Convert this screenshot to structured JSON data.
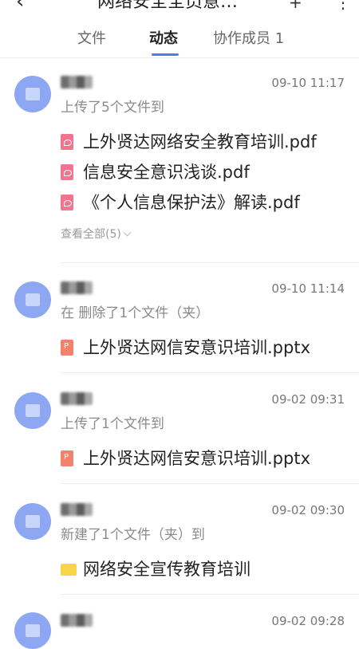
{
  "header": {
    "back_icon": "‹",
    "title": "网络安全全员意…",
    "extra1": "+",
    "extra2": "⋮"
  },
  "tabs": [
    {
      "label": "文件"
    },
    {
      "label": "动态"
    },
    {
      "label": "协作成员 1"
    }
  ],
  "activities": [
    {
      "time": "09-10 11:17",
      "action": "上传了5个文件到",
      "files": [
        {
          "type": "pdf",
          "name": "上外贤达网络安全教育培训.pdf"
        },
        {
          "type": "pdf",
          "name": "信息安全意识浅谈.pdf"
        },
        {
          "type": "pdf",
          "name": "《个人信息保护法》解读.pdf"
        }
      ],
      "view_all": "查看全部(5)"
    },
    {
      "time": "09-10 11:14",
      "action": "在  删除了1个文件（夹）",
      "files": [
        {
          "type": "ppt",
          "name": "上外贤达网信安意识培训.pptx"
        }
      ]
    },
    {
      "time": "09-02 09:31",
      "action": "上传了1个文件到",
      "files": [
        {
          "type": "ppt",
          "name": "上外贤达网信安意识培训.pptx"
        }
      ]
    },
    {
      "time": "09-02 09:30",
      "action": "新建了1个文件（夹）到",
      "files": [
        {
          "type": "folder",
          "name": "网络安全宣传教育培训"
        }
      ]
    },
    {
      "time": "09-02 09:28"
    }
  ],
  "colors": {
    "accent": "#4a7cf6",
    "avatar": "#8ea7f2",
    "pdf": "#f2748f",
    "ppt": "#f2826c",
    "folder": "#f8d44a"
  }
}
